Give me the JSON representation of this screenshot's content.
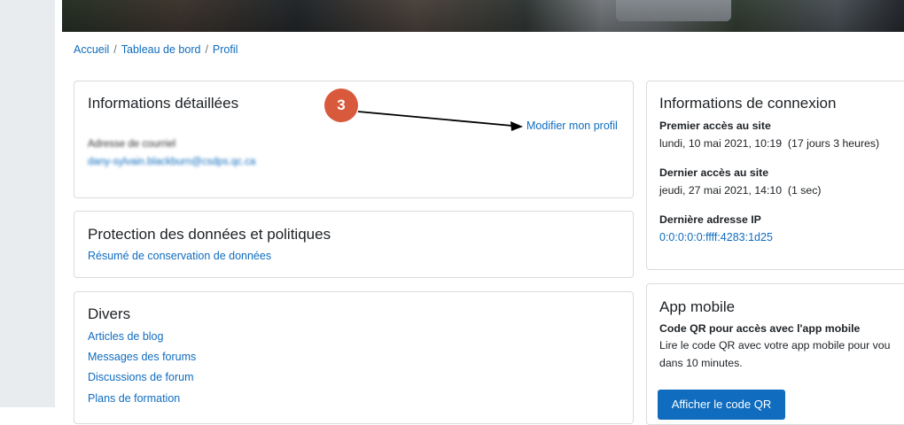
{
  "breadcrumb": {
    "items": [
      "Accueil",
      "Tableau de bord",
      "Profil"
    ],
    "separator": "/"
  },
  "details": {
    "title": "Informations détaillées",
    "edit_link": "Modifier mon profil",
    "email_label": "Adresse de courriel",
    "email_value": "dany-sylvain.blackburn@csdps.qc.ca"
  },
  "privacy": {
    "title": "Protection des données et politiques",
    "link": "Résumé de conservation de données"
  },
  "misc": {
    "title": "Divers",
    "links": [
      "Articles de blog",
      "Messages des forums",
      "Discussions de forum",
      "Plans de formation"
    ]
  },
  "login": {
    "title": "Informations de connexion",
    "first_access_label": "Premier accès au site",
    "first_access_value": "lundi, 10 mai 2021, 10:19  (17 jours 3 heures)",
    "last_access_label": "Dernier accès au site",
    "last_access_value": "jeudi, 27 mai 2021, 14:10  (1 sec)",
    "last_ip_label": "Dernière adresse IP",
    "last_ip_value": "0:0:0:0:0:ffff:4283:1d25"
  },
  "mobile": {
    "title": "App mobile",
    "qr_heading": "Code QR pour accès avec l'app mobile",
    "qr_desc_line1": "Lire le code QR avec votre app mobile pour vou",
    "qr_desc_line2": "dans 10 minutes.",
    "qr_button": "Afficher le code QR"
  },
  "annotation": {
    "step_number": "3"
  },
  "colors": {
    "link": "#0f6cbf",
    "badge": "#d9593c",
    "rail": "#e9ecef",
    "card_border": "#d8dbde"
  }
}
